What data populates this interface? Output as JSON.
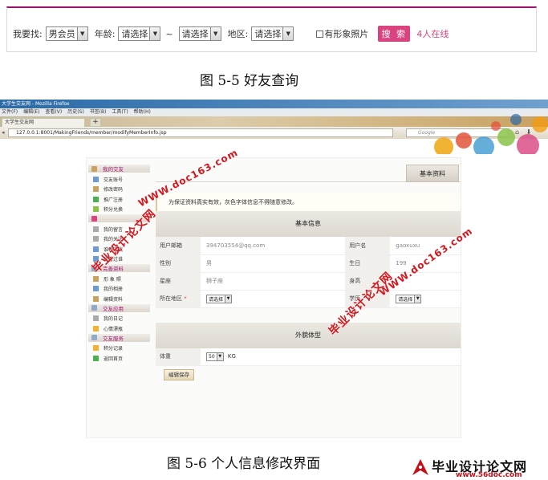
{
  "search_bar": {
    "label_find": "我要找:",
    "gender_value": "男会员",
    "label_age": "年龄:",
    "age_from": "请选择",
    "tilde": "~",
    "age_to": "请选择",
    "label_region": "地区:",
    "region_value": "请选择",
    "photo_checkbox_label": "有形象照片",
    "search_button": "搜 索",
    "online_count": "4人在线"
  },
  "caption_top": "图 5-5  好友查询",
  "browser": {
    "title": "大学生交友网 - Mozilla Firefox",
    "menus": [
      "文件(F)",
      "编辑(E)",
      "查看(V)",
      "历史(S)",
      "书签(B)",
      "工具(T)",
      "帮助(H)"
    ],
    "tab_title": "大学生交友网",
    "new_tab": "+",
    "url": "127.0.0.1:8001/MakingFriends/member/modifyMemberInfo.jsp",
    "search_placeholder": "Google",
    "accent_colors": [
      "#2b6aa7",
      "#c8a15f",
      "#d9437f"
    ]
  },
  "sidebar": {
    "groups": [
      {
        "title": "我的交友",
        "icon": "home-icon",
        "items": [
          "交友账号",
          "修改密码",
          "推广注册",
          "积分兑换"
        ]
      },
      {
        "title": "",
        "icon": "heart-icon",
        "items": [
          "我的留言",
          "我的关注",
          "谁看过我",
          "我看过谁"
        ]
      },
      {
        "title": "完善资料",
        "icon": "profile-icon",
        "items": [
          "形 象 照",
          "我的相册",
          "编辑资料"
        ]
      },
      {
        "title": "交友应用",
        "icon": "apps-icon",
        "items": [
          "我的日记",
          "心情漂瓶"
        ]
      },
      {
        "title": "交友服务",
        "icon": "service-icon",
        "items": [
          "积分记录",
          "返回首页"
        ]
      }
    ]
  },
  "profile": {
    "tab": "基本资料",
    "notice": "为保证资料真实有效，灰色字体信息不得随意修改。",
    "section_basic": "基本信息",
    "email_label": "用户邮箱",
    "email_value": "394703554@qq.com",
    "username_label": "用户名",
    "username_value": "gaoxuxu",
    "gender_label": "性别",
    "gender_value": "男",
    "birthday_label": "生日",
    "birthday_value": "199",
    "zodiac_label": "星座",
    "zodiac_value": "狮子座",
    "height_label": "身高",
    "height_value": "",
    "region_label": "所在地区",
    "required_mark": "*",
    "region_select": "请选择",
    "education_label": "学历",
    "education_select": "请选择",
    "section_body": "外貌体型",
    "weight_label": "体重",
    "weight_value": "50",
    "weight_unit": "KG",
    "save_button": "编辑保存"
  },
  "caption_bottom": "图 5-6  个人信息修改界面",
  "watermark": {
    "site": "WWW.doc163.com",
    "school": "毕业设计论文网"
  },
  "footer_logo": {
    "name": "毕业设计论文网",
    "url": "www.56doc.com"
  }
}
